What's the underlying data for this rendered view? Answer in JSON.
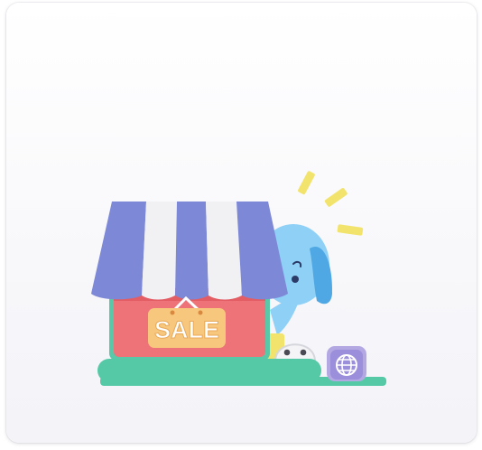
{
  "card": {
    "sign_text": "SALE"
  },
  "icons": {
    "shop": "storefront-icon",
    "mascot": "elephant-mascot-icon",
    "robot": "robot-head-icon",
    "globe": "globe-badge-icon"
  },
  "colors": {
    "awning_blue": "#7d88d6",
    "awning_white": "#f1f1f4",
    "shop_body": "#ee7378",
    "shop_frame": "#58c8a8",
    "sign_fill": "#f7c77d",
    "ground": "#55c9a6",
    "mascot_blue": "#8fd0f6",
    "sparkle_yellow": "#f2e36d",
    "badge_purple": "#b4a8e3"
  }
}
